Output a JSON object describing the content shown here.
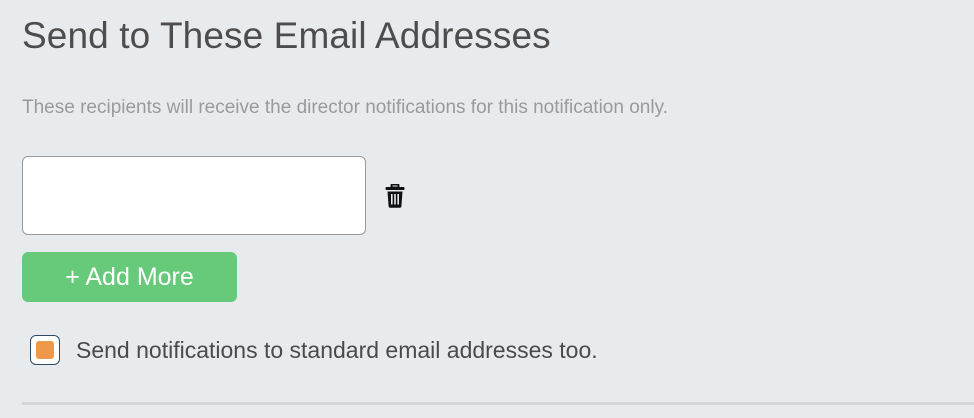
{
  "section": {
    "title": "Send to These Email Addresses",
    "description": "These recipients will receive the director notifications for this notification only."
  },
  "email_list": {
    "items": [
      {
        "value": "",
        "placeholder": "",
        "remove_icon": "trash-icon"
      }
    ]
  },
  "add_more_button": {
    "label": "+ Add More",
    "color": "#66ca7a"
  },
  "standard_emails_option": {
    "label": "Send notifications to standard email addresses too.",
    "checked": true,
    "accent_color": "#f0984a"
  }
}
